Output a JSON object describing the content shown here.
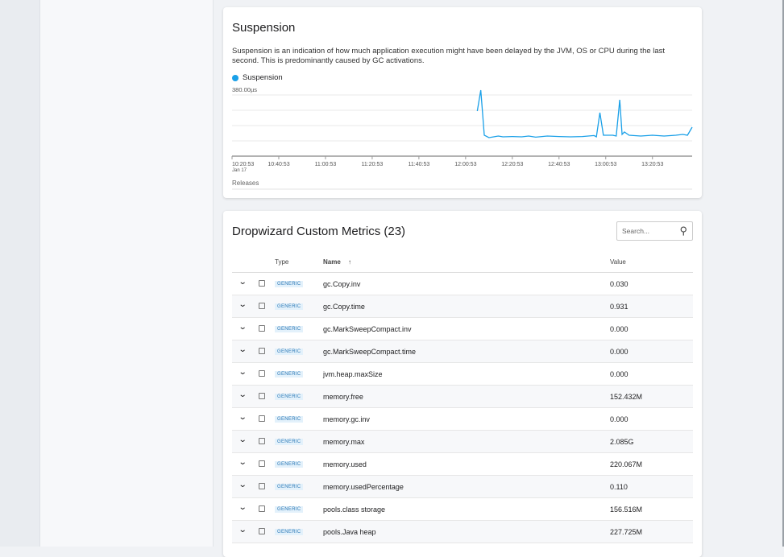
{
  "suspension": {
    "title": "Suspension",
    "description": "Suspension is an indication of how much application execution might have been delayed by the JVM, OS or CPU during the last second. This is predominantly caused by GC activations.",
    "legend": "Suspension",
    "releases_label": "Releases"
  },
  "chart_data": {
    "type": "line",
    "series": [
      {
        "name": "Suspension",
        "color": "#1aa0e8",
        "x": [
          "12:05:53",
          "12:07:23",
          "12:08:53",
          "12:10:53",
          "12:12:53",
          "12:14:53",
          "12:16:53",
          "12:20:53",
          "12:24:53",
          "12:27:53",
          "12:30:53",
          "12:35:53",
          "12:40:53",
          "12:45:53",
          "12:50:53",
          "12:55:53",
          "12:56:53",
          "12:58:23",
          "12:59:53",
          "13:03:53",
          "13:05:23",
          "13:06:53",
          "13:07:53",
          "13:08:53",
          "13:10:53",
          "13:15:53",
          "13:20:53",
          "13:25:53",
          "13:30:53",
          "13:33:53",
          "13:35:53",
          "13:37:53"
        ],
        "values": [
          280,
          410,
          130,
          115,
          120,
          125,
          120,
          122,
          120,
          125,
          118,
          125,
          122,
          120,
          122,
          128,
          120,
          270,
          130,
          130,
          125,
          350,
          135,
          150,
          130,
          125,
          130,
          125,
          130,
          135,
          130,
          180
        ]
      }
    ],
    "y_label_top": "380.00µs",
    "ylim": [
      0,
      380
    ],
    "x_ticks": [
      "10:20:53",
      "10:40:53",
      "11:00:53",
      "11:20:53",
      "11:40:53",
      "12:00:53",
      "12:20:53",
      "12:40:53",
      "13:00:53",
      "13:20:53"
    ],
    "x_tick_sub": "Jan 17",
    "xlim": [
      "10:20:53",
      "13:37:53"
    ],
    "grid": true
  },
  "metrics": {
    "title": "Dropwizard Custom Metrics (23)",
    "search_placeholder": "Search...",
    "columns": {
      "type": "Type",
      "name": "Name",
      "sort_icon": "↑",
      "value": "Value"
    },
    "rows": [
      {
        "type": "GENERIC",
        "name": "gc.Copy.inv",
        "value": "0.030"
      },
      {
        "type": "GENERIC",
        "name": "gc.Copy.time",
        "value": "0.931"
      },
      {
        "type": "GENERIC",
        "name": "gc.MarkSweepCompact.inv",
        "value": "0.000"
      },
      {
        "type": "GENERIC",
        "name": "gc.MarkSweepCompact.time",
        "value": "0.000"
      },
      {
        "type": "GENERIC",
        "name": "jvm.heap.maxSize",
        "value": "0.000"
      },
      {
        "type": "GENERIC",
        "name": "memory.free",
        "value": "152.432M"
      },
      {
        "type": "GENERIC",
        "name": "memory.gc.inv",
        "value": "0.000"
      },
      {
        "type": "GENERIC",
        "name": "memory.max",
        "value": "2.085G"
      },
      {
        "type": "GENERIC",
        "name": "memory.used",
        "value": "220.067M"
      },
      {
        "type": "GENERIC",
        "name": "memory.usedPercentage",
        "value": "0.110"
      },
      {
        "type": "GENERIC",
        "name": "pools.class storage",
        "value": "156.516M"
      },
      {
        "type": "GENERIC",
        "name": "pools.Java heap",
        "value": "227.725M"
      }
    ]
  }
}
